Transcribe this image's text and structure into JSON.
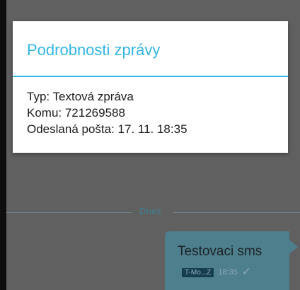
{
  "dialog": {
    "title": "Podrobnosti zprávy",
    "lines": [
      "Typ: Textová zpráva",
      "Komu: 721269588",
      "Odeslaná pošta: 17. 11. 18:35"
    ]
  },
  "thread": {
    "date_separator": "Dnes",
    "message": {
      "text": "Testovaci sms",
      "sim": "T-Mo...Z",
      "time": "18:35",
      "status_icon": "check-icon"
    }
  },
  "colors": {
    "accent": "#33b5e5",
    "bubble": "#4e7f8d"
  }
}
